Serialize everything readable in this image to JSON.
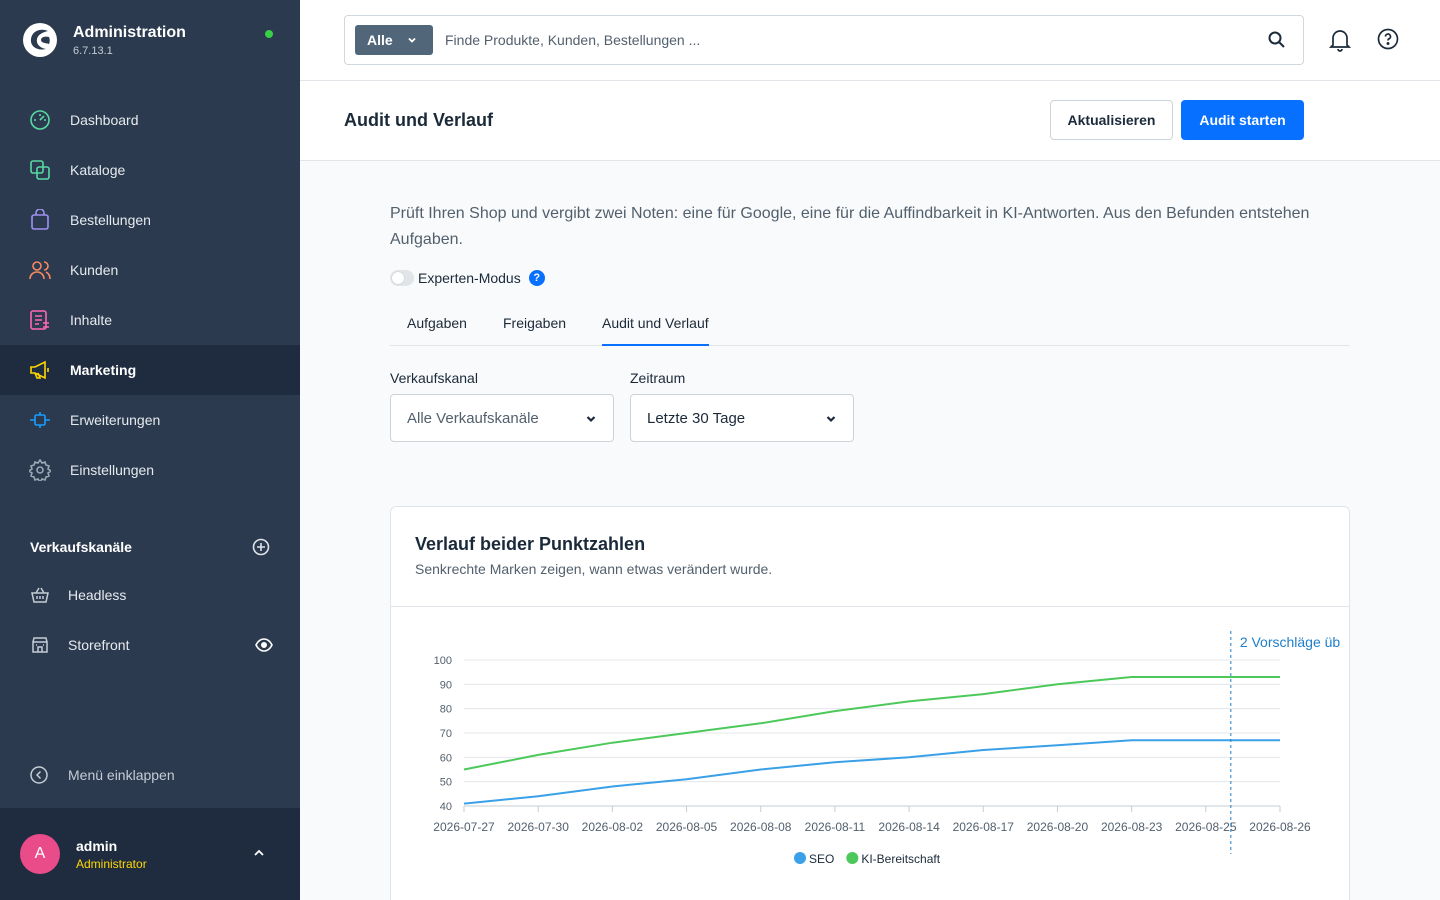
{
  "sidebar": {
    "brand": {
      "title": "Administration",
      "version": "6.7.13.1"
    },
    "nav": [
      {
        "label": "Dashboard",
        "icon": "dashboard-icon",
        "color": "#57d9a3"
      },
      {
        "label": "Kataloge",
        "icon": "catalog-icon",
        "color": "#57d9a3"
      },
      {
        "label": "Bestellungen",
        "icon": "bag-icon",
        "color": "#a092f0"
      },
      {
        "label": "Kunden",
        "icon": "users-icon",
        "color": "#f88962"
      },
      {
        "label": "Inhalte",
        "icon": "content-icon",
        "color": "#ff68b4"
      },
      {
        "label": "Marketing",
        "icon": "megaphone-icon",
        "color": "#ffd700",
        "active": true
      },
      {
        "label": "Erweiterungen",
        "icon": "plug-icon",
        "color": "#189eff"
      },
      {
        "label": "Einstellungen",
        "icon": "gear-icon",
        "color": "#9aa8b5"
      }
    ],
    "channels": {
      "title": "Verkaufskanäle",
      "items": [
        {
          "label": "Headless",
          "icon": "basket-icon"
        },
        {
          "label": "Storefront",
          "icon": "storefront-icon"
        }
      ]
    },
    "collapse_label": "Menü einklappen",
    "user": {
      "initial": "A",
      "name": "admin",
      "role": "Administrator"
    }
  },
  "topbar": {
    "search_type": "Alle",
    "search_placeholder": "Finde Produkte, Kunden, Bestellungen ..."
  },
  "page": {
    "title": "Audit und Verlauf",
    "refresh_label": "Aktualisieren",
    "start_label": "Audit starten",
    "intro": "Prüft Ihren Shop und vergibt zwei Noten: eine für Google, eine für die Auffindbarkeit in KI-Antworten. Aus den Befunden entstehen Aufgaben.",
    "expert_label": "Experten-Modus",
    "help_glyph": "?",
    "tabs": [
      {
        "label": "Aufgaben"
      },
      {
        "label": "Freigaben"
      },
      {
        "label": "Audit und Verlauf",
        "active": true
      }
    ],
    "filters": {
      "channel_label": "Verkaufskanal",
      "channel_value": "Alle Verkaufskanäle",
      "period_label": "Zeitraum",
      "period_value": "Letzte 30 Tage"
    },
    "card": {
      "title": "Verlauf beider Punktzahlen",
      "subtitle": "Senkrechte Marken zeigen, wann etwas verändert wurde."
    }
  },
  "colors": {
    "accent": "#0870ff",
    "seo": "#3aa0e8",
    "ki": "#4cc95a",
    "sidebar": "#2b3a4e"
  },
  "chart_data": {
    "type": "line",
    "x": [
      "2026-07-27",
      "2026-07-30",
      "2026-08-02",
      "2026-08-05",
      "2026-08-08",
      "2026-08-11",
      "2026-08-14",
      "2026-08-17",
      "2026-08-20",
      "2026-08-23",
      "2026-08-25",
      "2026-08-26"
    ],
    "x_ticks": [
      "2026-07-27",
      "2026-07-30",
      "2026-08-02",
      "2026-08-05",
      "2026-08-08",
      "2026-08-11",
      "2026-08-14",
      "2026-08-17",
      "2026-08-20",
      "2026-08-23",
      "2026-08-25",
      "2026-08-26"
    ],
    "series": [
      {
        "name": "SEO",
        "color": "#3aa0e8",
        "values": [
          41,
          44,
          48,
          51,
          55,
          58,
          60,
          63,
          65,
          67,
          67,
          67
        ]
      },
      {
        "name": "KI-Bereitschaft",
        "color": "#4cc95a",
        "values": [
          55,
          61,
          66,
          70,
          74,
          79,
          83,
          86,
          90,
          93,
          93,
          93
        ]
      }
    ],
    "ylim": [
      40,
      100
    ],
    "yticks": [
      40,
      50,
      60,
      70,
      80,
      90,
      100
    ],
    "grid": true,
    "legend": "bottom",
    "markers": [
      {
        "x": "2026-08-25",
        "label": "2 Vorschläge üb"
      }
    ]
  }
}
